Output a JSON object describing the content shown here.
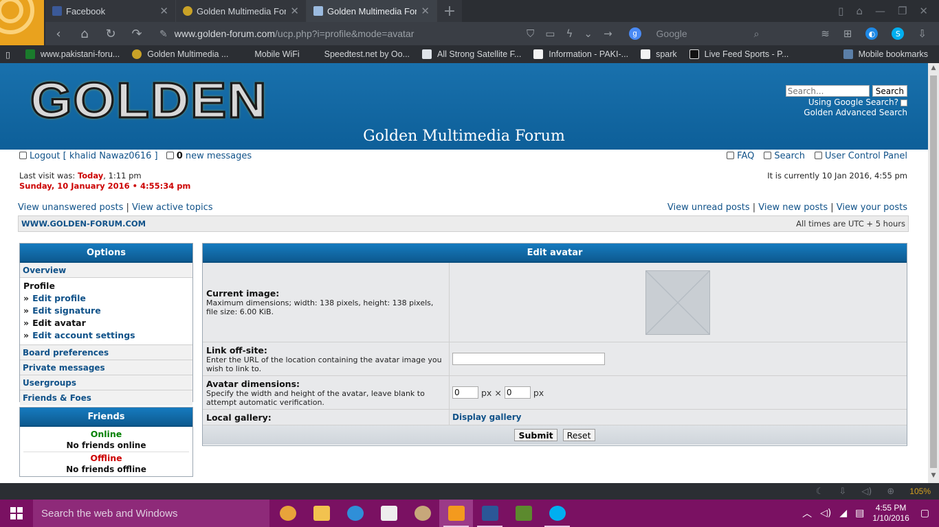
{
  "browser": {
    "tabs": [
      {
        "title": "Facebook",
        "color": "#3b5998"
      },
      {
        "title": "Golden Multimedia Foru",
        "color": "#c9a227"
      },
      {
        "title": "Golden Multimedia Foru",
        "color": "#2f6db5"
      }
    ],
    "url_host": "www.golden-forum.com",
    "url_path": "/ucp.php?i=profile&mode=avatar",
    "search_placeholder": "Google",
    "bookmarks": [
      "www.pakistani-foru...",
      "Golden Multimedia ...",
      "Mobile WiFi",
      "Speedtest.net by Oo...",
      "All Strong Satellite F...",
      "Information - PAKI-...",
      "spark",
      "Live Feed Sports - P...",
      "Mobile bookmarks"
    ],
    "zoom": "105%"
  },
  "header": {
    "logo_text": "GOLDEN",
    "site_name": "Golden Multimedia Forum",
    "search_placeholder": "Search...",
    "search_button": "Search",
    "google_label": "Using Google Search?",
    "advanced_search": "Golden Advanced Search"
  },
  "userbar": {
    "logout": "Logout [ khalid Nawaz0616 ]",
    "new_count": "0",
    "new_messages": "new messages",
    "faq": "FAQ",
    "search": "Search",
    "ucp": "User Control Panel"
  },
  "visit": {
    "last_visit_label": "Last visit was:",
    "last_visit_day": "Today",
    "last_visit_time": ", 1:11 pm",
    "now": "Sunday, 10 January 2016 • 4:55:34 pm",
    "currently": "It is currently 10 Jan 2016, 4:55 pm"
  },
  "quicklinks": {
    "unanswered": "View unanswered posts",
    "active": "View active topics",
    "unread": "View unread posts",
    "new_posts": "View new posts",
    "your_posts": "View your posts"
  },
  "navbar": {
    "site": "WWW.GOLDEN-FORUM.COM",
    "timezone": "All times are UTC + 5 hours"
  },
  "options": {
    "title": "Options",
    "overview": "Overview",
    "profile": "Profile",
    "sub": [
      "Edit profile",
      "Edit signature",
      "Edit avatar",
      "Edit account settings"
    ],
    "board_prefs": "Board preferences",
    "pm": "Private messages",
    "usergroups": "Usergroups",
    "friends_foes": "Friends & Foes"
  },
  "friends": {
    "title": "Friends",
    "online": "Online",
    "no_online": "No friends online",
    "offline": "Offline",
    "no_offline": "No friends offline"
  },
  "avatar": {
    "title": "Edit avatar",
    "current_label": "Current image:",
    "current_desc": "Maximum dimensions; width: 138 pixels, height: 138 pixels, file size: 6.00 KiB.",
    "link_label": "Link off-site:",
    "link_desc": "Enter the URL of the location containing the avatar image you wish to link to.",
    "link_value": "",
    "dim_label": "Avatar dimensions:",
    "dim_desc": "Specify the width and height of the avatar, leave blank to attempt automatic verification.",
    "width": "0",
    "height": "0",
    "unit": "px",
    "times": "×",
    "gallery_label": "Local gallery:",
    "gallery_link": "Display gallery",
    "submit": "Submit",
    "reset": "Reset"
  },
  "taskbar": {
    "search": "Search the web and Windows",
    "time": "4:55 PM",
    "date": "1/10/2016",
    "apps": [
      {
        "name": "chrome",
        "color": "#e8a33a"
      },
      {
        "name": "file-explorer",
        "color": "#f2c24f"
      },
      {
        "name": "internet-explorer",
        "color": "#2f8fd8"
      },
      {
        "name": "store",
        "color": "#eeeeee"
      },
      {
        "name": "paint",
        "color": "#c7a77a"
      },
      {
        "name": "uc-browser",
        "color": "#f39a1e"
      },
      {
        "name": "word",
        "color": "#2b5797"
      },
      {
        "name": "app-green",
        "color": "#5c8a2e"
      },
      {
        "name": "skype",
        "color": "#00aff0"
      }
    ]
  }
}
